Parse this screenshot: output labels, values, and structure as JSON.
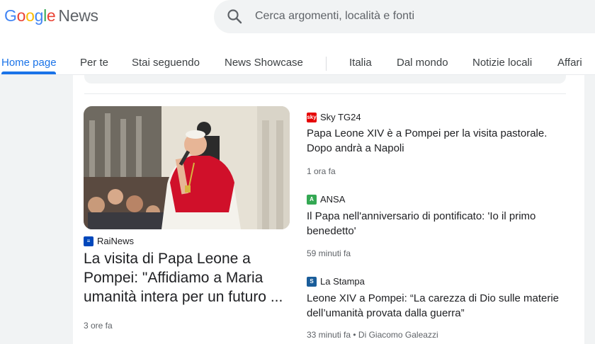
{
  "header": {
    "logo_google": [
      "G",
      "o",
      "o",
      "g",
      "l",
      "e"
    ],
    "logo_product": "News",
    "search_placeholder": "Cerca argomenti, località e fonti"
  },
  "tabs": [
    {
      "label": "Home page",
      "active": true
    },
    {
      "label": "Per te"
    },
    {
      "label": "Stai seguendo"
    },
    {
      "label": "News Showcase"
    },
    {
      "label": "Italia"
    },
    {
      "label": "Dal mondo"
    },
    {
      "label": "Notizie locali"
    },
    {
      "label": "Affari"
    }
  ],
  "main_story": {
    "source": "RaiNews",
    "headline": "La visita di Papa Leone a Pompei: \"Affidiamo a Maria umanità intera per un futuro ...",
    "time": "3 ore fa"
  },
  "stories": [
    {
      "source": "Sky TG24",
      "headline": "Papa Leone XIV è a Pompei per la visita pastorale. Dopo andrà a Napoli",
      "time": "1 ora fa",
      "color": "#e60000"
    },
    {
      "source": "ANSA",
      "headline": "Il Papa nell'anniversario di pontificato: 'Io il primo benedetto'",
      "time": "59 minuti fa",
      "color": "#34a853"
    },
    {
      "source": "La Stampa",
      "headline": "Leone XIV a Pompei: “La carezza di Dio sulle materie dell’umanità provata dalla guerra”",
      "time": "33 minuti fa • Di Giacomo Galeazzi",
      "color": "#1a5d9a"
    }
  ],
  "colors": {
    "accent": "#1a73e8",
    "rainews": "#0047bb"
  }
}
